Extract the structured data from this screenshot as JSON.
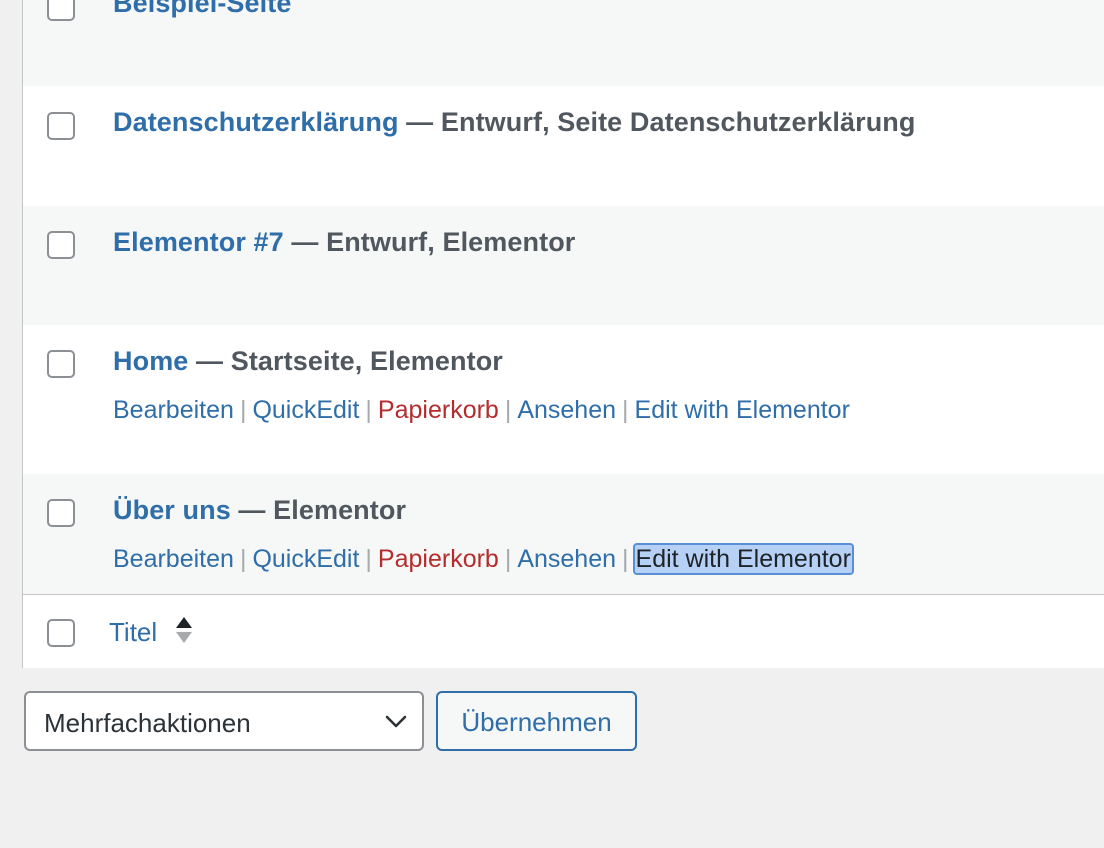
{
  "rows": [
    {
      "title": "Beispiel-Seite",
      "suffix": ""
    },
    {
      "title": "Datenschutzerklärung",
      "suffix": " — Entwurf, Seite Datenschutzerklärung"
    },
    {
      "title": "Elementor #7",
      "suffix": " — Entwurf, Elementor"
    },
    {
      "title": "Home",
      "suffix": " — Startseite, Elementor",
      "actions": {
        "edit": "Bearbeiten",
        "quickedit": "QuickEdit",
        "trash": "Papierkorb",
        "view": "Ansehen",
        "elementor": "Edit with Elementor"
      }
    },
    {
      "title": "Über uns",
      "suffix": " — Elementor",
      "actions": {
        "edit": "Bearbeiten",
        "quickedit": "QuickEdit",
        "trash": "Papierkorb",
        "view": "Ansehen",
        "elementor": "Edit with Elementor"
      }
    }
  ],
  "footer": {
    "column_title": "Titel",
    "sort_icon": "sort-arrows-icon"
  },
  "bulk_actions": {
    "selected": "Mehrfachaktionen",
    "icon": "chevron-down-icon"
  },
  "apply_button": {
    "label": "Übernehmen"
  },
  "colors": {
    "link": "#2f6ea8",
    "trash": "#b32d2e",
    "selection": "#b6d1f5"
  }
}
